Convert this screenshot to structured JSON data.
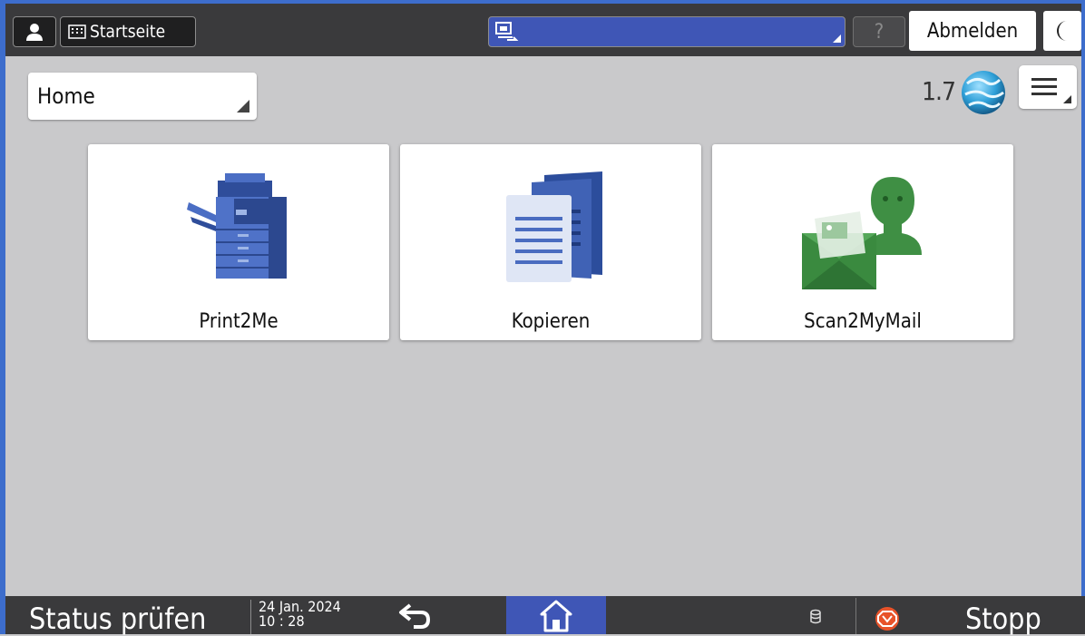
{
  "topbar": {
    "home_label": "Startseite",
    "help_label": "?",
    "logout_label": "Abmelden"
  },
  "screen": {
    "dropdown_value": "Home",
    "counter": "1.7"
  },
  "tiles": [
    {
      "label": "Print2Me",
      "icon": "printer-icon"
    },
    {
      "label": "Kopieren",
      "icon": "copy-documents-icon"
    },
    {
      "label": "Scan2MyMail",
      "icon": "scan-mail-icon"
    }
  ],
  "bottombar": {
    "status_label": "Status prüfen",
    "date": "24 Jan. 2024",
    "time": "10 : 28",
    "stop_label": "Stopp"
  },
  "colors": {
    "accent_blue": "#3f56b6",
    "bar_dark": "#3a3a3c",
    "screen_bg": "#c9c9cb",
    "stop_red": "#e8532a"
  }
}
